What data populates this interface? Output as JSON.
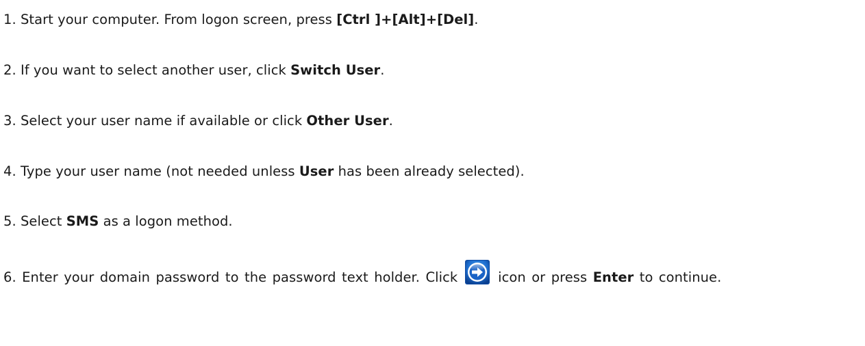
{
  "steps": [
    {
      "number": "1.",
      "text_before": "Start your computer. From logon screen, press ",
      "bold": "[Ctrl ]+[Alt]+[Del]",
      "text_after": "."
    },
    {
      "number": "2.",
      "text_before": "If you want to select another user, click ",
      "bold": "Switch User",
      "text_after": "."
    },
    {
      "number": "3.",
      "text_before": "Select your user name if available or click ",
      "bold": "Other User",
      "text_after": "."
    },
    {
      "number": "4.",
      "text_before": "Type your user name (not needed unless ",
      "bold": "User",
      "text_after": " has been already selected)."
    },
    {
      "number": "5.",
      "text_before": "Select ",
      "bold": "SMS",
      "text_after": " as a logon method."
    },
    {
      "number": "6.",
      "text_before": "Enter your domain password to the password text holder. Click ",
      "icon": "arrow-right-circle-icon",
      "text_middle": " icon or press ",
      "bold": "Enter",
      "text_after": " to continue."
    }
  ],
  "colors": {
    "text": "#1a1a1a",
    "icon_fill": "#1f6fd0",
    "icon_dark": "#0a3f8f",
    "icon_arrow": "#ffffff"
  }
}
